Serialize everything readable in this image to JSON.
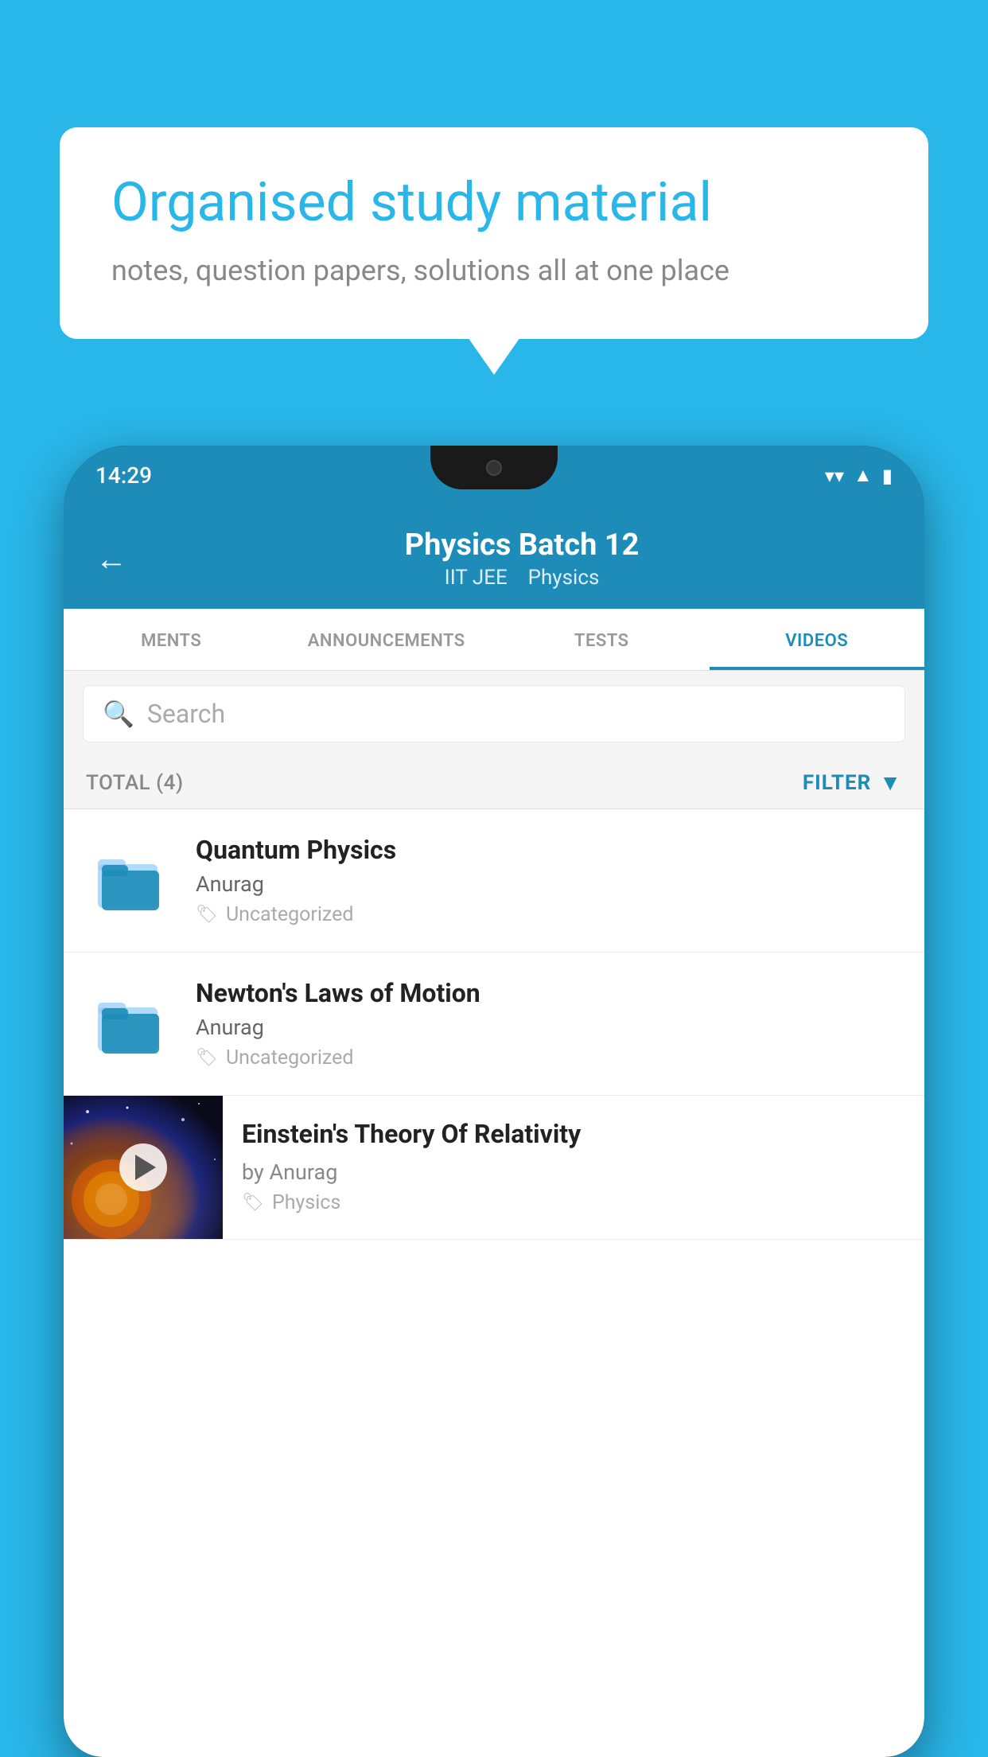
{
  "background": {
    "color": "#29b6e8"
  },
  "speech_bubble": {
    "heading": "Organised study material",
    "subtext": "notes, question papers, solutions all at one place"
  },
  "status_bar": {
    "time": "14:29",
    "icons": [
      "wifi",
      "signal",
      "battery"
    ]
  },
  "app_header": {
    "back_label": "←",
    "title": "Physics Batch 12",
    "subtitle_parts": [
      "IIT JEE",
      "Physics"
    ]
  },
  "tabs": [
    {
      "label": "MENTS",
      "active": false
    },
    {
      "label": "ANNOUNCEMENTS",
      "active": false
    },
    {
      "label": "TESTS",
      "active": false
    },
    {
      "label": "VIDEOS",
      "active": true
    }
  ],
  "search": {
    "placeholder": "Search"
  },
  "filter_bar": {
    "total_label": "TOTAL (4)",
    "filter_label": "FILTER"
  },
  "video_items": [
    {
      "title": "Quantum Physics",
      "author": "Anurag",
      "tag": "Uncategorized",
      "type": "folder"
    },
    {
      "title": "Newton's Laws of Motion",
      "author": "Anurag",
      "tag": "Uncategorized",
      "type": "folder"
    },
    {
      "title": "Einstein's Theory Of Relativity",
      "author": "by Anurag",
      "tag": "Physics",
      "type": "video"
    }
  ]
}
